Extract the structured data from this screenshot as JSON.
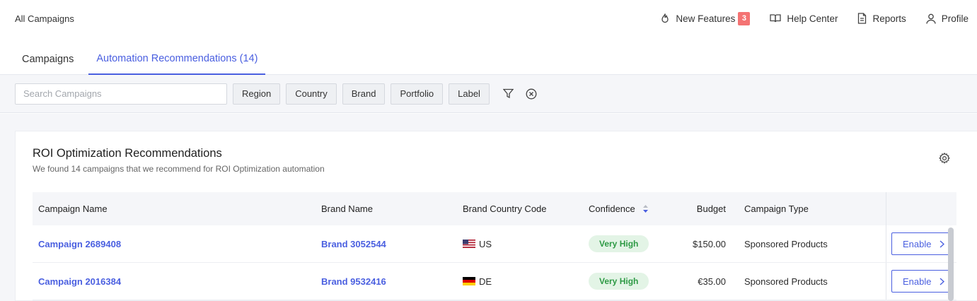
{
  "header": {
    "breadcrumb": "All Campaigns",
    "links": {
      "new_features": "New Features",
      "new_features_count": "3",
      "help_center": "Help Center",
      "reports": "Reports",
      "profile": "Profile"
    }
  },
  "tabs": [
    {
      "label": "Campaigns",
      "active": false
    },
    {
      "label": "Automation Recommendations (14)",
      "active": true
    }
  ],
  "filters": {
    "search_placeholder": "Search Campaigns",
    "chips": [
      "Region",
      "Country",
      "Brand",
      "Portfolio",
      "Label"
    ]
  },
  "card": {
    "title": "ROI Optimization Recommendations",
    "subtitle": "We found 14 campaigns that we recommend for ROI Optimization automation"
  },
  "table": {
    "columns": {
      "campaign_name": "Campaign Name",
      "brand_name": "Brand Name",
      "brand_country_code": "Brand Country Code",
      "confidence": "Confidence",
      "budget": "Budget",
      "campaign_type": "Campaign Type"
    },
    "rows": [
      {
        "campaign": "Campaign 2689408",
        "brand": "Brand 3052544",
        "country": "US",
        "confidence": "Very High",
        "budget": "$150.00",
        "type": "Sponsored Products",
        "action": "Enable"
      },
      {
        "campaign": "Campaign 2016384",
        "brand": "Brand 9532416",
        "country": "DE",
        "confidence": "Very High",
        "budget": "€35.00",
        "type": "Sponsored Products",
        "action": "Enable"
      }
    ]
  },
  "colors": {
    "accent": "#4a5fe0",
    "badge": "#f47373",
    "confidence_bg": "#e3f4e6",
    "confidence_text": "#2e9a45"
  }
}
